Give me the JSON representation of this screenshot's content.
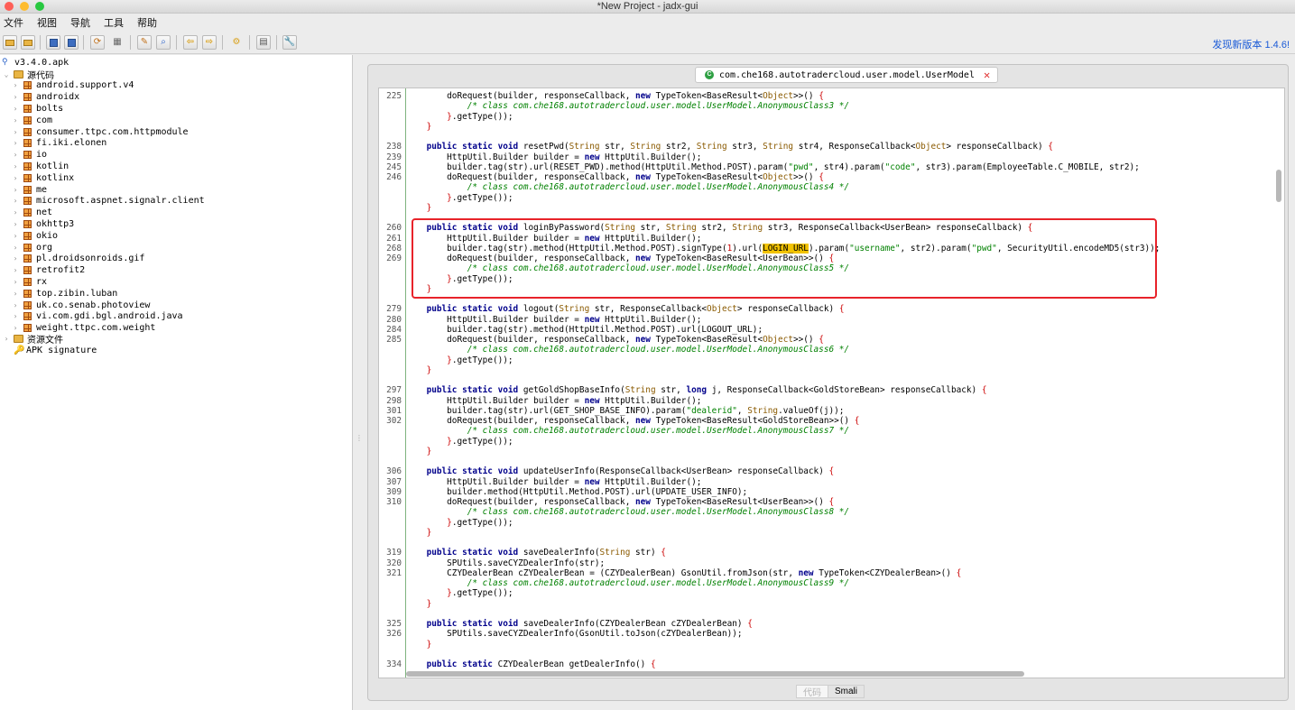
{
  "window": {
    "title": "*New Project - jadx-gui"
  },
  "menu": [
    "文件",
    "视图",
    "导航",
    "工具",
    "帮助"
  ],
  "update_link": "发现新版本 1.4.6!",
  "toolbar_icons": [
    "open-file-icon",
    "add-files-icon",
    "save-icon",
    "save-all-icon",
    "sync-icon",
    "flatten-packages-icon",
    "search-text-icon",
    "search-class-icon",
    "back-icon",
    "forward-icon",
    "decompile-icon",
    "log-icon",
    "preferences-icon"
  ],
  "tree": {
    "root": "v3.4.0.apk",
    "source_folder": "源代码",
    "packages": [
      "android.support.v4",
      "androidx",
      "bolts",
      "com",
      "consumer.ttpc.com.httpmodule",
      "fi.iki.elonen",
      "io",
      "kotlin",
      "kotlinx",
      "me",
      "microsoft.aspnet.signalr.client",
      "net",
      "okhttp3",
      "okio",
      "org",
      "pl.droidsonroids.gif",
      "retrofit2",
      "rx",
      "top.zibin.luban",
      "uk.co.senab.photoview",
      "vi.com.gdi.bgl.android.java",
      "weight.ttpc.com.weight"
    ],
    "resources": "资源文件",
    "signature": "APK signature"
  },
  "editor": {
    "tab_title": "com.che168.autotradercloud.user.model.UserModel",
    "bottom_tabs": [
      "代码",
      "Smali"
    ],
    "lines": [
      {
        "n": "225",
        "html": "        doRequest(builder, responseCallback, <span class=\"kw\">new</span> TypeToken&lt;BaseResult&lt;<span class=\"ty\">Object</span>&gt;&gt;() <span class=\"br\">{</span>"
      },
      {
        "n": "",
        "html": "            <span class=\"com\">/* class com.che168.autotradercloud.user.model.UserModel.AnonymousClass3 */</span>"
      },
      {
        "n": "",
        "html": "        <span class=\"br\">}</span>.getType());"
      },
      {
        "n": "",
        "html": "    <span class=\"br\">}</span>"
      },
      {
        "n": "",
        "html": ""
      },
      {
        "n": "238",
        "html": "    <span class=\"kw\">public static void</span> resetPwd(<span class=\"ty\">String</span> str, <span class=\"ty\">String</span> str2, <span class=\"ty\">String</span> str3, <span class=\"ty\">String</span> str4, ResponseCallback&lt;<span class=\"ty\">Object</span>&gt; responseCallback) <span class=\"br\">{</span>"
      },
      {
        "n": "239",
        "html": "        HttpUtil.Builder builder = <span class=\"kw\">new</span> HttpUtil.Builder();"
      },
      {
        "n": "245",
        "html": "        builder.tag(str).url(RESET_PWD).method(HttpUtil.Method.POST).param(<span class=\"str\">\"pwd\"</span>, str4).param(<span class=\"str\">\"code\"</span>, str3).param(EmployeeTable.C_MOBILE, str2);"
      },
      {
        "n": "246",
        "html": "        doRequest(builder, responseCallback, <span class=\"kw\">new</span> TypeToken&lt;BaseResult&lt;<span class=\"ty\">Object</span>&gt;&gt;() <span class=\"br\">{</span>"
      },
      {
        "n": "",
        "html": "            <span class=\"com\">/* class com.che168.autotradercloud.user.model.UserModel.AnonymousClass4 */</span>"
      },
      {
        "n": "",
        "html": "        <span class=\"br\">}</span>.getType());"
      },
      {
        "n": "",
        "html": "    <span class=\"br\">}</span>"
      },
      {
        "n": "",
        "html": ""
      },
      {
        "n": "260",
        "html": "    <span class=\"kw\">public static void</span> loginByPassword(<span class=\"ty\">String</span> str, <span class=\"ty\">String</span> str2, <span class=\"ty\">String</span> str3, ResponseCallback&lt;UserBean&gt; responseCallback) <span class=\"br\">{</span>"
      },
      {
        "n": "261",
        "html": "        HttpUtil.Builder builder = <span class=\"kw\">new</span> HttpUtil.Builder();"
      },
      {
        "n": "268",
        "html": "        builder.tag(str).method(HttpUtil.Method.POST).signType(<span class=\"br\">1</span>).url(<span class=\"hl\">LOGIN_URL</span>).param(<span class=\"str\">\"username\"</span>, str2).param(<span class=\"str\">\"pwd\"</span>, SecurityUtil.encodeMD5(str3));"
      },
      {
        "n": "269",
        "html": "        doRequest(builder, responseCallback, <span class=\"kw\">new</span> TypeToken&lt;BaseResult&lt;UserBean&gt;&gt;() <span class=\"br\">{</span>"
      },
      {
        "n": "",
        "html": "            <span class=\"com\">/* class com.che168.autotradercloud.user.model.UserModel.AnonymousClass5 */</span>"
      },
      {
        "n": "",
        "html": "        <span class=\"br\">}</span>.getType());"
      },
      {
        "n": "",
        "html": "    <span class=\"br\">}</span>"
      },
      {
        "n": "",
        "html": ""
      },
      {
        "n": "279",
        "html": "    <span class=\"kw\">public static void</span> logout(<span class=\"ty\">String</span> str, ResponseCallback&lt;<span class=\"ty\">Object</span>&gt; responseCallback) <span class=\"br\">{</span>"
      },
      {
        "n": "280",
        "html": "        HttpUtil.Builder builder = <span class=\"kw\">new</span> HttpUtil.Builder();"
      },
      {
        "n": "284",
        "html": "        builder.tag(str).method(HttpUtil.Method.POST).url(LOGOUT_URL);"
      },
      {
        "n": "285",
        "html": "        doRequest(builder, responseCallback, <span class=\"kw\">new</span> TypeToken&lt;BaseResult&lt;<span class=\"ty\">Object</span>&gt;&gt;() <span class=\"br\">{</span>"
      },
      {
        "n": "",
        "html": "            <span class=\"com\">/* class com.che168.autotradercloud.user.model.UserModel.AnonymousClass6 */</span>"
      },
      {
        "n": "",
        "html": "        <span class=\"br\">}</span>.getType());"
      },
      {
        "n": "",
        "html": "    <span class=\"br\">}</span>"
      },
      {
        "n": "",
        "html": ""
      },
      {
        "n": "297",
        "html": "    <span class=\"kw\">public static void</span> getGoldShopBaseInfo(<span class=\"ty\">String</span> str, <span class=\"kw\">long</span> j, ResponseCallback&lt;GoldStoreBean&gt; responseCallback) <span class=\"br\">{</span>"
      },
      {
        "n": "298",
        "html": "        HttpUtil.Builder builder = <span class=\"kw\">new</span> HttpUtil.Builder();"
      },
      {
        "n": "301",
        "html": "        builder.tag(str).url(GET_SHOP_BASE_INFO).param(<span class=\"str\">\"dealerid\"</span>, <span class=\"ty\">String</span>.valueOf(j));"
      },
      {
        "n": "302",
        "html": "        doRequest(builder, responseCallback, <span class=\"kw\">new</span> TypeToken&lt;BaseResult&lt;GoldStoreBean&gt;&gt;() <span class=\"br\">{</span>"
      },
      {
        "n": "",
        "html": "            <span class=\"com\">/* class com.che168.autotradercloud.user.model.UserModel.AnonymousClass7 */</span>"
      },
      {
        "n": "",
        "html": "        <span class=\"br\">}</span>.getType());"
      },
      {
        "n": "",
        "html": "    <span class=\"br\">}</span>"
      },
      {
        "n": "",
        "html": ""
      },
      {
        "n": "306",
        "html": "    <span class=\"kw\">public static void</span> updateUserInfo(ResponseCallback&lt;UserBean&gt; responseCallback) <span class=\"br\">{</span>"
      },
      {
        "n": "307",
        "html": "        HttpUtil.Builder builder = <span class=\"kw\">new</span> HttpUtil.Builder();"
      },
      {
        "n": "309",
        "html": "        builder.method(HttpUtil.Method.POST).url(UPDATE_USER_INFO);"
      },
      {
        "n": "310",
        "html": "        doRequest(builder, responseCallback, <span class=\"kw\">new</span> TypeToken&lt;BaseResult&lt;UserBean&gt;&gt;() <span class=\"br\">{</span>"
      },
      {
        "n": "",
        "html": "            <span class=\"com\">/* class com.che168.autotradercloud.user.model.UserModel.AnonymousClass8 */</span>"
      },
      {
        "n": "",
        "html": "        <span class=\"br\">}</span>.getType());"
      },
      {
        "n": "",
        "html": "    <span class=\"br\">}</span>"
      },
      {
        "n": "",
        "html": ""
      },
      {
        "n": "319",
        "html": "    <span class=\"kw\">public static void</span> saveDealerInfo(<span class=\"ty\">String</span> str) <span class=\"br\">{</span>"
      },
      {
        "n": "320",
        "html": "        SPUtils.saveCYZDealerInfo(str);"
      },
      {
        "n": "321",
        "html": "        CZYDealerBean cZYDealerBean = (CZYDealerBean) GsonUtil.fromJson(str, <span class=\"kw\">new</span> TypeToken&lt;CZYDealerBean&gt;() <span class=\"br\">{</span>"
      },
      {
        "n": "",
        "html": "            <span class=\"com\">/* class com.che168.autotradercloud.user.model.UserModel.AnonymousClass9 */</span>"
      },
      {
        "n": "",
        "html": "        <span class=\"br\">}</span>.getType());"
      },
      {
        "n": "",
        "html": "    <span class=\"br\">}</span>"
      },
      {
        "n": "",
        "html": ""
      },
      {
        "n": "325",
        "html": "    <span class=\"kw\">public static void</span> saveDealerInfo(CZYDealerBean cZYDealerBean) <span class=\"br\">{</span>"
      },
      {
        "n": "326",
        "html": "        SPUtils.saveCYZDealerInfo(GsonUtil.toJson(cZYDealerBean));"
      },
      {
        "n": "",
        "html": "    <span class=\"br\">}</span>"
      },
      {
        "n": "",
        "html": ""
      },
      {
        "n": "334",
        "html": "    <span class=\"kw\">public static</span> CZYDealerBean getDealerInfo() <span class=\"br\">{</span>"
      }
    ]
  }
}
